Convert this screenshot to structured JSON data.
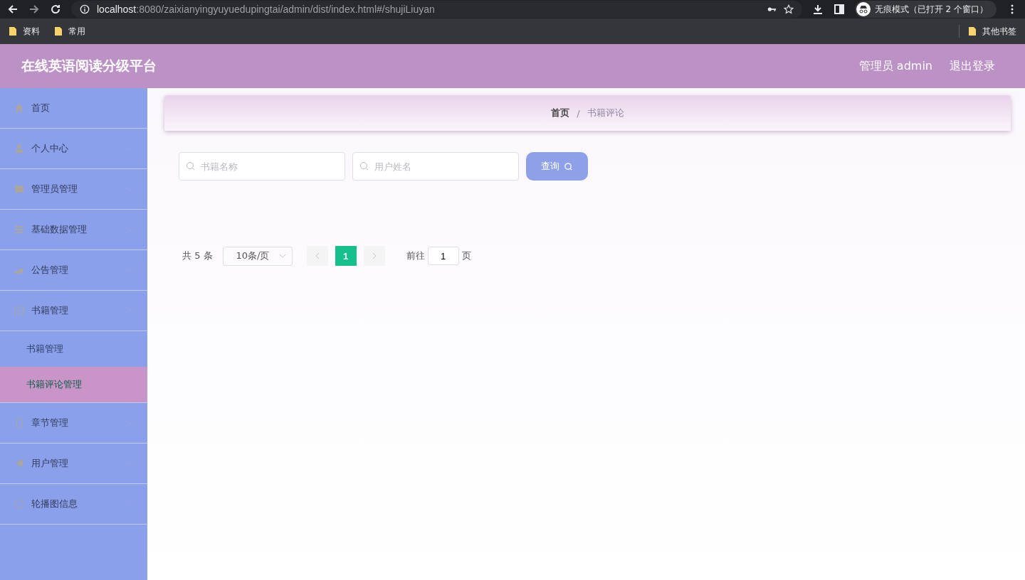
{
  "browser": {
    "url_host": "localhost",
    "url_rest": ":8080/zaixianyingyuyuedupingtai/admin/dist/index.html#/shujiLiuyan",
    "incognito": "无痕模式（已打开 2 个窗口）",
    "bookmarks": [
      "资料",
      "常用"
    ],
    "other_bookmarks": "其他书签"
  },
  "header": {
    "title": "在线英语阅读分级平台",
    "user": "管理员 admin",
    "logout": "退出登录"
  },
  "menu": [
    {
      "label": "首页"
    },
    {
      "label": "个人中心",
      "expanded": false
    },
    {
      "label": "管理员管理",
      "expanded": false
    },
    {
      "label": "基础数据管理",
      "expanded": false
    },
    {
      "label": "公告管理",
      "expanded": false
    },
    {
      "label": "书籍管理",
      "expanded": true,
      "children": [
        {
          "label": "书籍管理",
          "selected": false
        },
        {
          "label": "书籍评论管理",
          "selected": true
        }
      ]
    },
    {
      "label": "章节管理",
      "expanded": false
    },
    {
      "label": "用户管理",
      "expanded": false
    },
    {
      "label": "轮播图信息",
      "expanded": false
    }
  ],
  "breadcrumb": [
    "首页",
    "书籍评论"
  ],
  "breadcrumb_separator": "/",
  "search": {
    "fields": [
      {
        "placeholder": "书籍名称"
      },
      {
        "placeholder": "用户姓名"
      }
    ],
    "button": "查询"
  },
  "pagination": {
    "total": "共 5 条",
    "page_size": "10条/页",
    "pages": [
      {
        "label": "1",
        "selected": true
      }
    ],
    "goto": "前往",
    "goto_value": "1",
    "page_unit": "页"
  }
}
